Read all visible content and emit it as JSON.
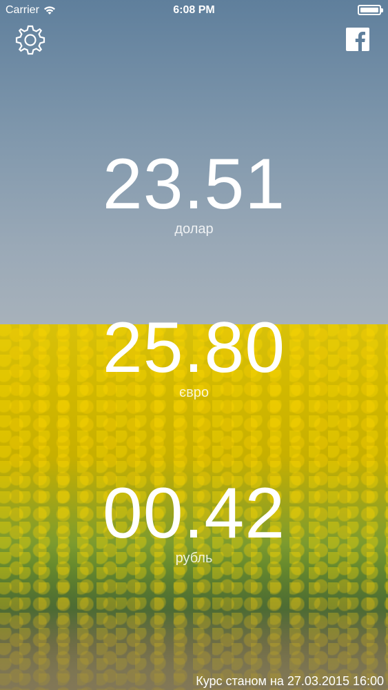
{
  "status_bar": {
    "carrier": "Carrier",
    "time": "6:08 PM"
  },
  "toolbar": {
    "settings_icon": "gear-icon",
    "facebook_icon": "facebook-icon"
  },
  "rates": [
    {
      "value": "23.51",
      "label": "долар"
    },
    {
      "value": "25.80",
      "label": "євро"
    },
    {
      "value": "00.42",
      "label": "рубль"
    }
  ],
  "footer": {
    "text": "Курс станом на 27.03.2015 16:00"
  },
  "colors": {
    "sky": "#7f97ac",
    "field": "#d1b800",
    "text": "#ffffff"
  }
}
